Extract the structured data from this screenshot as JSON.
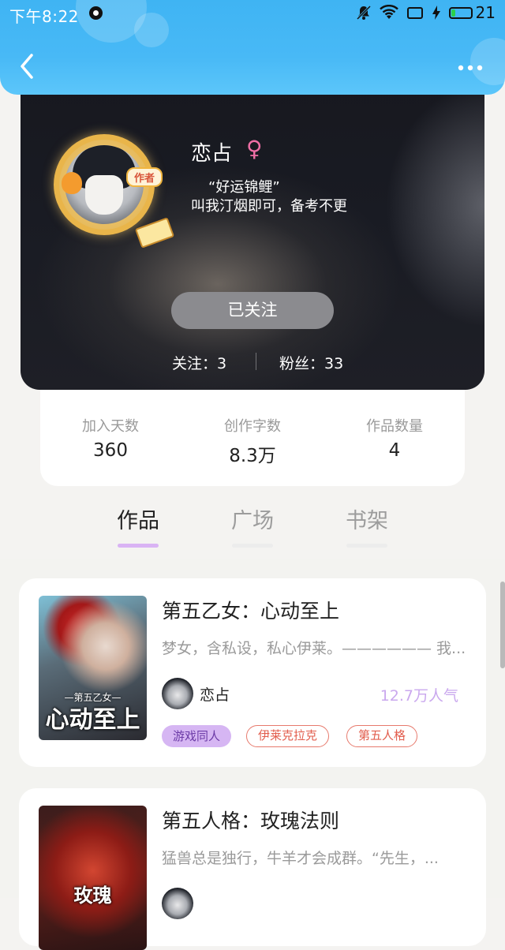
{
  "status_bar": {
    "time": "下午8:22",
    "battery": "21"
  },
  "colors": {
    "header": "#48b9f6",
    "accent_purple": "#d6b6f3",
    "tag_red": "#e25d4d",
    "popularity": "#caa8ee",
    "battery_green": "#2bd14a"
  },
  "nav": {
    "back_icon": "chevron-left-icon",
    "more_icon": "more-dots-icon"
  },
  "profile": {
    "badge": "作者",
    "nickname": "恋占",
    "gender_symbol": "♀",
    "motto_line1": "“好运锦鲤”",
    "motto_line2": "叫我汀烟即可，备考不更",
    "follow_button": "已关注",
    "following": "关注：3",
    "fans": "粉丝：33"
  },
  "numbers": [
    {
      "label": "加入天数",
      "value": "360"
    },
    {
      "label": "创作字数",
      "value": "8.3万"
    },
    {
      "label": "作品数量",
      "value": "4"
    }
  ],
  "tabs": [
    {
      "label": "作品",
      "active": true
    },
    {
      "label": "广场",
      "active": false
    },
    {
      "label": "书架",
      "active": false
    }
  ],
  "books": [
    {
      "title": "第五乙女：心动至上",
      "description": "梦女，含私设，私心伊莱。—————— 我...",
      "author": "恋占",
      "popularity": "12.7万人气",
      "cover_title": "心动至上",
      "cover_sub": "—第五乙女—",
      "tags": [
        "游戏同人",
        "伊莱克拉克",
        "第五人格"
      ]
    },
    {
      "title": "第五人格：玫瑰法则",
      "description": "猛兽总是独行，牛羊才会成群。“先生，...",
      "cover_title": "玫瑰"
    }
  ]
}
